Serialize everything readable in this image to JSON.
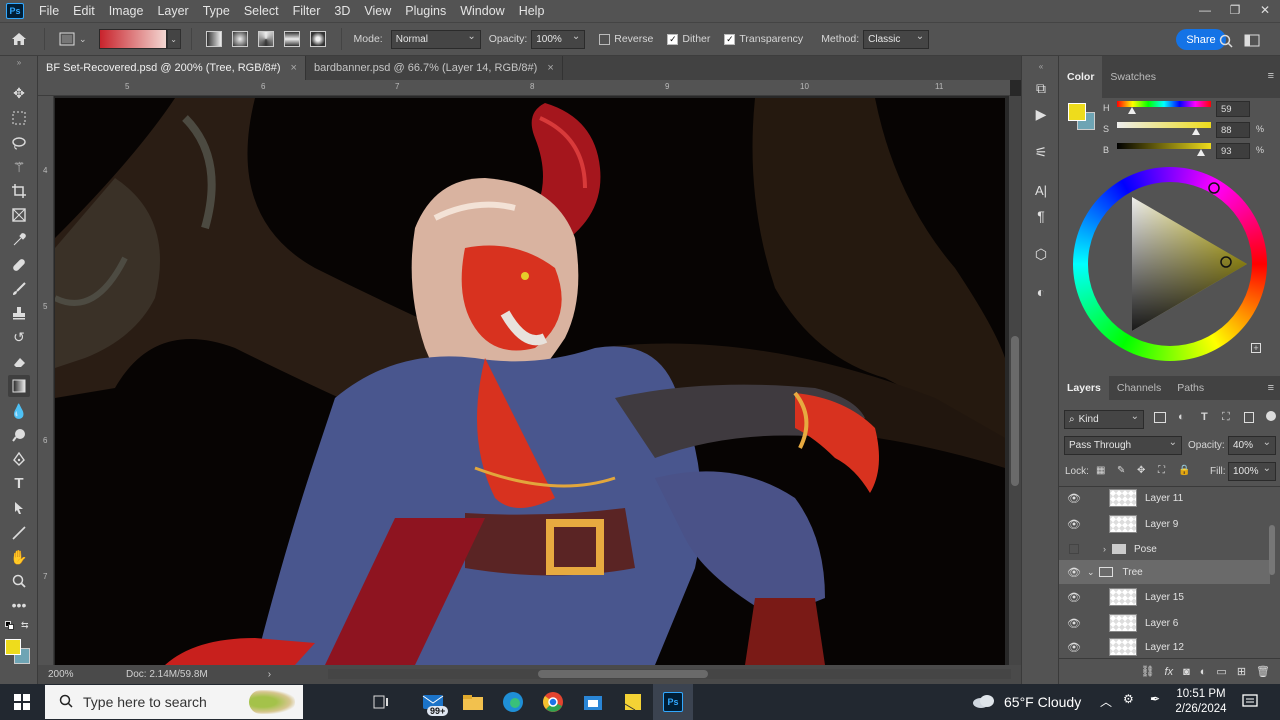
{
  "app": {
    "logo": "Ps"
  },
  "menu": [
    "File",
    "Edit",
    "Image",
    "Layer",
    "Type",
    "Select",
    "Filter",
    "3D",
    "View",
    "Plugins",
    "Window",
    "Help"
  ],
  "options": {
    "mode_label": "Mode:",
    "mode_value": "Normal",
    "opacity_label": "Opacity:",
    "opacity_value": "100%",
    "reverse_label": "Reverse",
    "dither_label": "Dither",
    "transparency_label": "Transparency",
    "method_label": "Method:",
    "method_value": "Classic",
    "share_label": "Share",
    "reverse_checked": false,
    "dither_checked": true,
    "transparency_checked": true
  },
  "tabs": [
    {
      "label": "BF Set-Recovered.psd @ 200% (Tree, RGB/8#)",
      "active": true
    },
    {
      "label": "bardbanner.psd @ 66.7% (Layer 14, RGB/8#)",
      "active": false
    }
  ],
  "ruler": {
    "h": [
      "5",
      "6",
      "7",
      "8",
      "9",
      "10",
      "11"
    ],
    "v": [
      "4",
      "5",
      "6",
      "7"
    ]
  },
  "status": {
    "zoom": "200%",
    "doc": "Doc: 2.14M/59.8M"
  },
  "color_panel": {
    "tabs": [
      "Color",
      "Swatches"
    ],
    "h_label": "H",
    "s_label": "S",
    "b_label": "B",
    "h_value": "59",
    "s_value": "88",
    "b_value": "93",
    "pct": "%",
    "foreground": "#eedc1c",
    "background": "#6ea4b4"
  },
  "layers_panel": {
    "tabs": [
      "Layers",
      "Channels",
      "Paths"
    ],
    "kind_label": "Kind",
    "blend_mode": "Pass Through",
    "opacity_label": "Opacity:",
    "opacity_value": "40%",
    "lock_label": "Lock:",
    "fill_label": "Fill:",
    "fill_value": "100%",
    "layers": [
      {
        "name": "Layer 11",
        "visible": true,
        "type": "layer"
      },
      {
        "name": "Layer 9",
        "visible": true,
        "type": "layer"
      },
      {
        "name": "Pose",
        "visible": false,
        "type": "group"
      },
      {
        "name": "Tree",
        "visible": true,
        "type": "group-open",
        "selected": true
      },
      {
        "name": "Layer 15",
        "visible": true,
        "type": "layer"
      },
      {
        "name": "Layer 6",
        "visible": true,
        "type": "layer"
      },
      {
        "name": "Layer 12",
        "visible": true,
        "type": "layer"
      }
    ]
  },
  "taskbar": {
    "search_placeholder": "Type here to search",
    "weather": "65°F  Cloudy",
    "time": "10:51 PM",
    "date": "2/26/2024",
    "mail_badge": "99+"
  }
}
